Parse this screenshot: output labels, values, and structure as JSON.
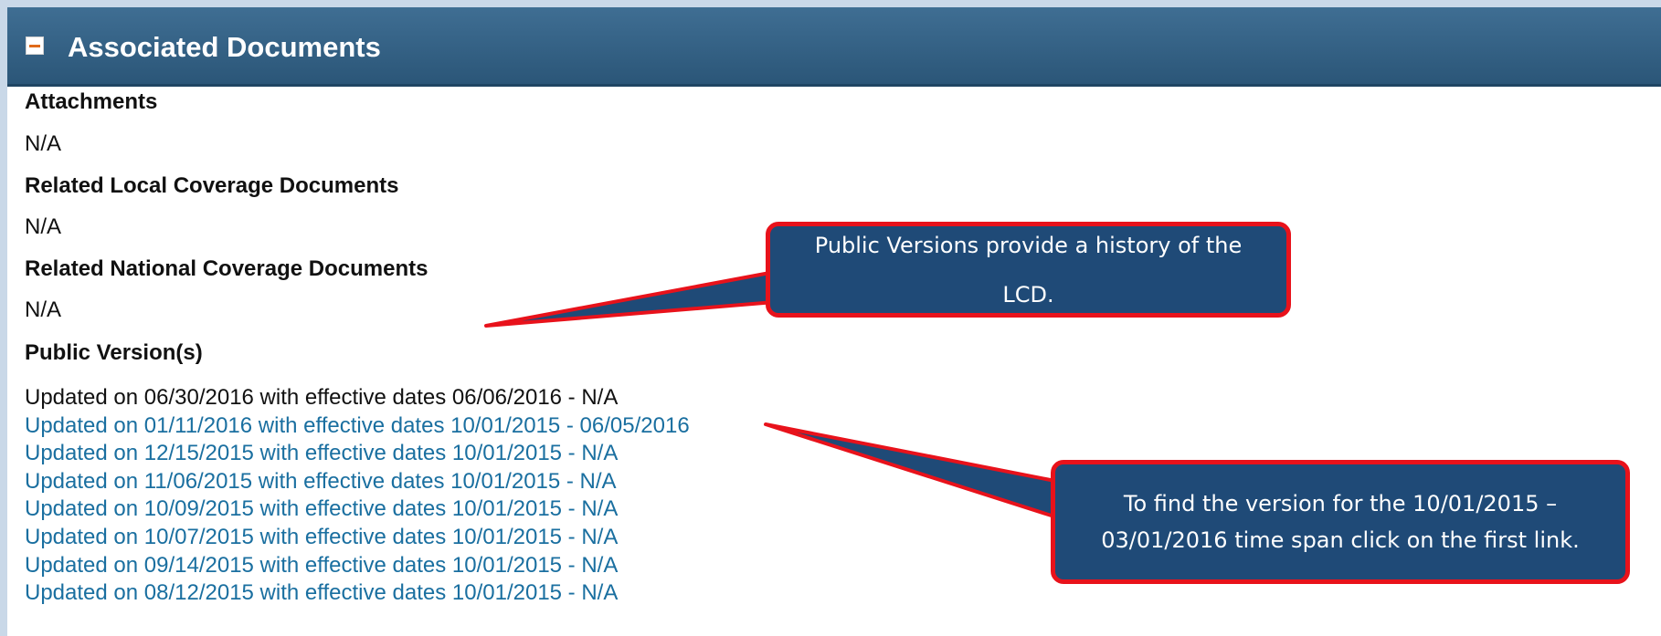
{
  "panel": {
    "title": "Associated Documents",
    "collapse_icon": "minus-square-icon",
    "header_color": "#2f5d82",
    "collapse_color": "#e06a1a"
  },
  "sections": {
    "attachments": {
      "heading": "Attachments",
      "value": "N/A"
    },
    "related_local": {
      "heading": "Related Local Coverage Documents",
      "value": "N/A"
    },
    "related_national": {
      "heading": "Related National Coverage Documents",
      "value": "N/A"
    },
    "public_versions": {
      "heading": "Public Version(s)",
      "items": [
        "Updated on 06/30/2016 with effective dates 06/06/2016 - N/A",
        "Updated on 01/11/2016 with effective dates 10/01/2015 - 06/05/2016",
        "Updated on 12/15/2015 with effective dates 10/01/2015 - N/A",
        "Updated on 11/06/2015 with effective dates 10/01/2015 - N/A",
        "Updated on 10/09/2015 with effective dates 10/01/2015 - N/A",
        "Updated on 10/07/2015 with effective dates 10/01/2015 - N/A",
        "Updated on 09/14/2015 with effective dates 10/01/2015 - N/A",
        "Updated on 08/12/2015 with effective dates 10/01/2015 - N/A"
      ]
    }
  },
  "callouts": {
    "public_versions": {
      "line1": "Public Versions provide a history of the",
      "line2": "LCD."
    },
    "find_version": {
      "line1": "To find the version for the 10/01/2015 –",
      "line2": "03/01/2016 time span click on the first link."
    },
    "fill_color": "#1f4a77",
    "border_color": "#e8121b"
  },
  "colors": {
    "link": "#1a6fa0",
    "text": "#111111"
  }
}
